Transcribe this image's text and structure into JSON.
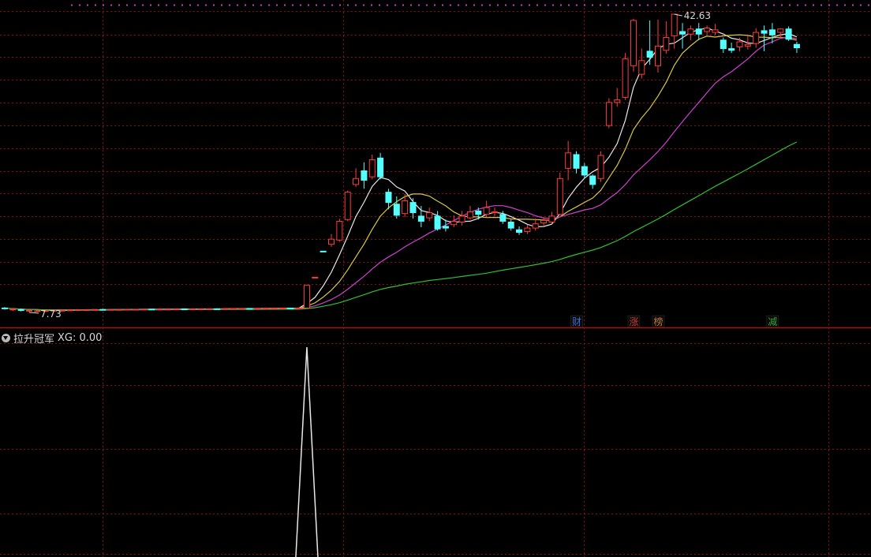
{
  "chart_data": {
    "type": "candlestick",
    "candles": [
      {
        "o": 8.25,
        "c": 8.22,
        "h": 8.35,
        "l": 8.05,
        "up": false
      },
      {
        "o": 8.1,
        "c": 8.12,
        "h": 8.25,
        "l": 7.9,
        "up": true
      },
      {
        "o": 8.05,
        "c": 8.02,
        "h": 8.18,
        "l": 7.85,
        "up": false
      },
      {
        "o": 7.95,
        "c": 7.98,
        "h": 8.1,
        "l": 7.73,
        "up": true
      },
      {
        "o": 7.9,
        "c": 7.92,
        "h": 8.0,
        "l": 7.8,
        "up": true
      },
      {
        "o": 7.92,
        "c": 7.95,
        "h": 8.05,
        "l": 7.85,
        "up": true
      },
      {
        "o": 7.95,
        "c": 7.98,
        "h": 8.05,
        "l": 7.9,
        "up": true
      },
      {
        "o": 7.98,
        "c": 7.98,
        "h": 8.05,
        "l": 7.92,
        "up": true
      },
      {
        "o": 7.98,
        "c": 8.02,
        "h": 8.08,
        "l": 7.94,
        "up": true
      },
      {
        "o": 8.02,
        "c": 8.05,
        "h": 8.1,
        "l": 7.98,
        "up": true
      },
      {
        "o": 8.05,
        "c": 8.05,
        "h": 8.1,
        "l": 8.0,
        "up": true
      },
      {
        "o": 8.05,
        "c": 8.08,
        "h": 8.12,
        "l": 8.0,
        "up": true
      },
      {
        "o": 8.08,
        "c": 8.06,
        "h": 8.12,
        "l": 8.02,
        "up": false
      },
      {
        "o": 8.06,
        "c": 8.08,
        "h": 8.12,
        "l": 8.02,
        "up": true
      },
      {
        "o": 8.08,
        "c": 8.08,
        "h": 8.12,
        "l": 8.04,
        "up": true
      },
      {
        "o": 8.08,
        "c": 8.1,
        "h": 8.14,
        "l": 8.04,
        "up": true
      },
      {
        "o": 8.1,
        "c": 8.1,
        "h": 8.14,
        "l": 8.06,
        "up": true
      },
      {
        "o": 8.1,
        "c": 8.12,
        "h": 8.16,
        "l": 8.06,
        "up": true
      },
      {
        "o": 8.12,
        "c": 8.1,
        "h": 8.15,
        "l": 8.06,
        "up": false
      },
      {
        "o": 8.1,
        "c": 8.12,
        "h": 8.16,
        "l": 8.06,
        "up": true
      },
      {
        "o": 8.12,
        "c": 8.12,
        "h": 8.16,
        "l": 8.08,
        "up": true
      },
      {
        "o": 8.12,
        "c": 8.14,
        "h": 8.18,
        "l": 8.08,
        "up": true
      },
      {
        "o": 8.14,
        "c": 8.12,
        "h": 8.18,
        "l": 8.08,
        "up": false
      },
      {
        "o": 8.12,
        "c": 8.14,
        "h": 8.18,
        "l": 8.08,
        "up": true
      },
      {
        "o": 8.14,
        "c": 8.14,
        "h": 8.18,
        "l": 8.1,
        "up": true
      },
      {
        "o": 8.14,
        "c": 8.16,
        "h": 8.2,
        "l": 8.1,
        "up": true
      },
      {
        "o": 8.16,
        "c": 8.14,
        "h": 8.2,
        "l": 8.1,
        "up": false
      },
      {
        "o": 8.14,
        "c": 8.18,
        "h": 8.22,
        "l": 8.1,
        "up": true
      },
      {
        "o": 8.18,
        "c": 8.18,
        "h": 8.22,
        "l": 8.14,
        "up": true
      },
      {
        "o": 8.18,
        "c": 8.2,
        "h": 8.24,
        "l": 8.14,
        "up": true
      },
      {
        "o": 8.2,
        "c": 8.18,
        "h": 8.24,
        "l": 8.14,
        "up": false
      },
      {
        "o": 8.18,
        "c": 8.2,
        "h": 8.24,
        "l": 8.14,
        "up": true
      },
      {
        "o": 8.2,
        "c": 8.22,
        "h": 8.26,
        "l": 8.16,
        "up": true
      },
      {
        "o": 8.22,
        "c": 8.22,
        "h": 8.26,
        "l": 8.18,
        "up": true
      },
      {
        "o": 8.22,
        "c": 8.24,
        "h": 8.28,
        "l": 8.18,
        "up": true
      },
      {
        "o": 8.24,
        "c": 8.22,
        "h": 8.28,
        "l": 8.18,
        "up": false
      },
      {
        "o": 8.22,
        "c": 8.25,
        "h": 8.3,
        "l": 8.18,
        "up": true
      },
      {
        "o": 8.25,
        "c": 10.9,
        "h": 10.95,
        "l": 8.25,
        "up": true
      },
      {
        "o": 11.85,
        "c": 11.85,
        "h": 11.85,
        "l": 11.85,
        "up": true
      },
      {
        "o": 14.9,
        "c": 14.9,
        "h": 14.9,
        "l": 14.9,
        "up": false
      },
      {
        "o": 15.7,
        "c": 16.3,
        "h": 16.9,
        "l": 15.4,
        "up": true
      },
      {
        "o": 16.2,
        "c": 18.4,
        "h": 18.7,
        "l": 16.0,
        "up": true
      },
      {
        "o": 18.6,
        "c": 21.8,
        "h": 22.0,
        "l": 18.4,
        "up": true
      },
      {
        "o": 22.7,
        "c": 23.4,
        "h": 24.6,
        "l": 22.4,
        "up": true
      },
      {
        "o": 24.3,
        "c": 23.2,
        "h": 25.3,
        "l": 22.2,
        "up": false
      },
      {
        "o": 23.6,
        "c": 25.6,
        "h": 26.2,
        "l": 23.3,
        "up": true
      },
      {
        "o": 25.8,
        "c": 23.6,
        "h": 26.4,
        "l": 23.3,
        "up": false
      },
      {
        "o": 21.8,
        "c": 20.6,
        "h": 22.2,
        "l": 19.8,
        "up": false
      },
      {
        "o": 20.4,
        "c": 19.1,
        "h": 21.3,
        "l": 18.7,
        "up": false
      },
      {
        "o": 19.3,
        "c": 20.8,
        "h": 21.6,
        "l": 18.9,
        "up": true
      },
      {
        "o": 20.6,
        "c": 19.4,
        "h": 21.1,
        "l": 18.7,
        "up": false
      },
      {
        "o": 19.0,
        "c": 18.4,
        "h": 20.2,
        "l": 17.7,
        "up": false
      },
      {
        "o": 18.8,
        "c": 19.4,
        "h": 20.0,
        "l": 18.4,
        "up": true
      },
      {
        "o": 19.0,
        "c": 17.5,
        "h": 19.6,
        "l": 17.3,
        "up": false
      },
      {
        "o": 17.8,
        "c": 17.6,
        "h": 18.6,
        "l": 17.2,
        "up": false
      },
      {
        "o": 18.0,
        "c": 18.4,
        "h": 19.1,
        "l": 17.7,
        "up": true
      },
      {
        "o": 18.3,
        "c": 19.0,
        "h": 19.6,
        "l": 17.9,
        "up": true
      },
      {
        "o": 18.8,
        "c": 19.5,
        "h": 20.2,
        "l": 18.6,
        "up": true
      },
      {
        "o": 19.6,
        "c": 19.2,
        "h": 20.0,
        "l": 18.6,
        "up": false
      },
      {
        "o": 19.2,
        "c": 20.0,
        "h": 20.8,
        "l": 18.9,
        "up": true
      },
      {
        "o": 19.4,
        "c": 19.5,
        "h": 20.0,
        "l": 19.0,
        "up": true
      },
      {
        "o": 19.2,
        "c": 18.4,
        "h": 19.6,
        "l": 18.1,
        "up": false
      },
      {
        "o": 18.3,
        "c": 17.6,
        "h": 18.6,
        "l": 17.3,
        "up": false
      },
      {
        "o": 17.4,
        "c": 17.1,
        "h": 17.8,
        "l": 16.8,
        "up": false
      },
      {
        "o": 17.2,
        "c": 17.6,
        "h": 18.0,
        "l": 16.9,
        "up": true
      },
      {
        "o": 17.6,
        "c": 18.1,
        "h": 18.7,
        "l": 17.3,
        "up": true
      },
      {
        "o": 18.2,
        "c": 18.5,
        "h": 18.9,
        "l": 17.9,
        "up": true
      },
      {
        "o": 18.3,
        "c": 19.0,
        "h": 19.5,
        "l": 18.1,
        "up": true
      },
      {
        "o": 19.2,
        "c": 23.4,
        "h": 24.1,
        "l": 19.1,
        "up": true
      },
      {
        "o": 24.6,
        "c": 26.4,
        "h": 27.8,
        "l": 23.2,
        "up": true
      },
      {
        "o": 26.2,
        "c": 24.6,
        "h": 26.6,
        "l": 24.0,
        "up": false
      },
      {
        "o": 24.8,
        "c": 23.8,
        "h": 25.2,
        "l": 23.4,
        "up": false
      },
      {
        "o": 23.7,
        "c": 22.7,
        "h": 23.9,
        "l": 22.2,
        "up": false
      },
      {
        "o": 23.4,
        "c": 26.1,
        "h": 26.6,
        "l": 23.0,
        "up": true
      },
      {
        "o": 29.6,
        "c": 32.3,
        "h": 32.8,
        "l": 29.3,
        "up": true
      },
      {
        "o": 32.3,
        "c": 32.6,
        "h": 34.0,
        "l": 31.8,
        "up": true
      },
      {
        "o": 32.9,
        "c": 37.4,
        "h": 38.1,
        "l": 32.6,
        "up": true
      },
      {
        "o": 36.6,
        "c": 41.9,
        "h": 42.1,
        "l": 35.9,
        "up": true
      },
      {
        "o": 35.6,
        "c": 37.2,
        "h": 38.6,
        "l": 35.1,
        "up": true
      },
      {
        "o": 38.3,
        "c": 37.6,
        "h": 41.9,
        "l": 36.7,
        "up": false
      },
      {
        "o": 36.6,
        "c": 38.9,
        "h": 42.0,
        "l": 35.8,
        "up": true
      },
      {
        "o": 38.4,
        "c": 39.9,
        "h": 41.8,
        "l": 38.0,
        "up": true
      },
      {
        "o": 40.1,
        "c": 42.63,
        "h": 42.63,
        "l": 38.6,
        "up": true
      },
      {
        "o": 40.6,
        "c": 40.3,
        "h": 41.6,
        "l": 38.6,
        "up": false
      },
      {
        "o": 40.3,
        "c": 40.9,
        "h": 41.3,
        "l": 39.6,
        "up": true
      },
      {
        "o": 40.9,
        "c": 40.3,
        "h": 41.6,
        "l": 39.6,
        "up": false
      },
      {
        "o": 40.6,
        "c": 41.0,
        "h": 41.3,
        "l": 40.2,
        "up": true
      },
      {
        "o": 40.5,
        "c": 40.8,
        "h": 41.5,
        "l": 40.2,
        "up": true
      },
      {
        "o": 39.6,
        "c": 38.6,
        "h": 39.9,
        "l": 38.1,
        "up": false
      },
      {
        "o": 38.6,
        "c": 38.4,
        "h": 39.3,
        "l": 38.1,
        "up": false
      },
      {
        "o": 38.8,
        "c": 39.4,
        "h": 39.9,
        "l": 38.3,
        "up": true
      },
      {
        "o": 38.9,
        "c": 39.1,
        "h": 40.1,
        "l": 38.5,
        "up": true
      },
      {
        "o": 39.2,
        "c": 40.5,
        "h": 41.0,
        "l": 38.7,
        "up": true
      },
      {
        "o": 40.7,
        "c": 40.4,
        "h": 41.3,
        "l": 38.3,
        "up": false
      },
      {
        "o": 40.8,
        "c": 40.2,
        "h": 41.6,
        "l": 39.2,
        "up": false
      },
      {
        "o": 40.5,
        "c": 40.9,
        "h": 41.0,
        "l": 39.8,
        "up": true
      },
      {
        "o": 40.9,
        "c": 39.7,
        "h": 41.2,
        "l": 39.5,
        "up": false
      },
      {
        "o": 39.1,
        "c": 38.7,
        "h": 39.4,
        "l": 38.1,
        "up": false
      }
    ],
    "high_label": "42.63",
    "low_label": "7.73",
    "markers": [
      {
        "index": 70,
        "label": "财",
        "color": "#3d6bd0"
      },
      {
        "index": 77,
        "label": "涨",
        "color": "#d03a3a"
      },
      {
        "index": 80,
        "label": "榜",
        "color": "#c07a3a"
      },
      {
        "index": 94,
        "label": "减",
        "color": "#3aa53a"
      }
    ],
    "ma_colors": [
      "#e8e8e8",
      "#d8c840",
      "#d040d0",
      "#30c030"
    ],
    "up_color": "#ff3b3b",
    "down_color": "#54ffff",
    "grid_color": "#8a1010",
    "indicator": {
      "name": "拉升冠军",
      "series_label": "XG: 0.00",
      "signal_index": 37,
      "signal_value": 1
    }
  }
}
